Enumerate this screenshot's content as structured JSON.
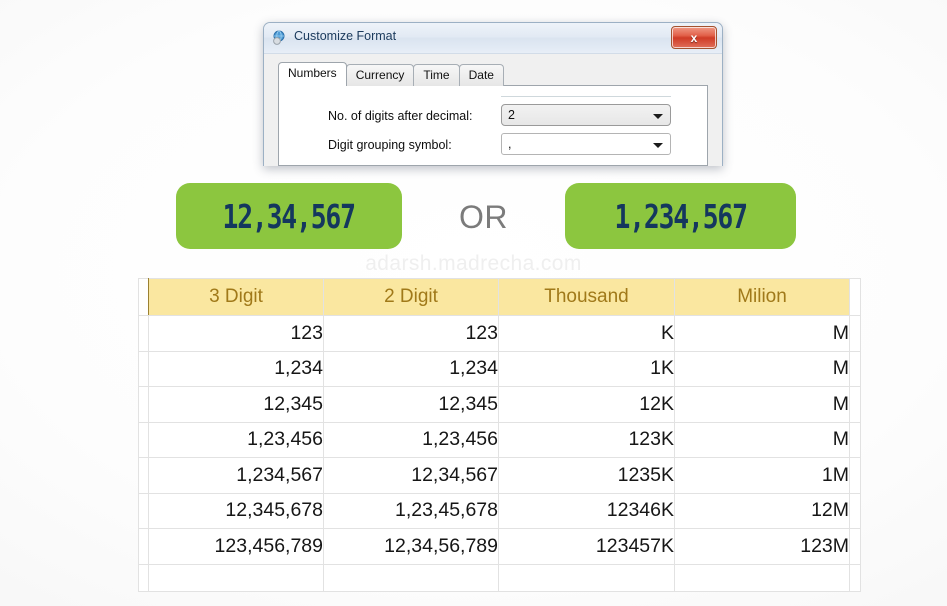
{
  "watermark": "adarsh.madrecha.com",
  "colors": {
    "green": "#8CC63F",
    "green_text": "#14375E",
    "header_yellow": "#FAE7A0",
    "header_text": "#A07919",
    "or_text": "#7B7B7B"
  },
  "dialog": {
    "title": "Customize Format",
    "icon": "globe-icon",
    "close_label": "x",
    "tabs": [
      {
        "label": "Numbers",
        "active": true
      },
      {
        "label": "Currency",
        "active": false
      },
      {
        "label": "Time",
        "active": false
      },
      {
        "label": "Date",
        "active": false
      }
    ],
    "fields": [
      {
        "label": "No. of digits after decimal:",
        "value": "2"
      },
      {
        "label": "Digit grouping symbol:",
        "value": ","
      }
    ]
  },
  "comparison": {
    "left_value": "12,34,567",
    "separator": "OR",
    "right_value": "1,234,567"
  },
  "table": {
    "headers": [
      "3 Digit",
      "2 Digit",
      "Thousand",
      "Milion"
    ],
    "rows": [
      [
        "123",
        "123",
        "K",
        "M"
      ],
      [
        "1,234",
        "1,234",
        "1K",
        "M"
      ],
      [
        "12,345",
        "12,345",
        "12K",
        "M"
      ],
      [
        "1,23,456",
        "1,23,456",
        "123K",
        "M"
      ],
      [
        "1,234,567",
        "12,34,567",
        "1235K",
        "1M"
      ],
      [
        "12,345,678",
        "1,23,45,678",
        "12346K",
        "12M"
      ],
      [
        "123,456,789",
        "12,34,56,789",
        "123457K",
        "123M"
      ]
    ]
  }
}
